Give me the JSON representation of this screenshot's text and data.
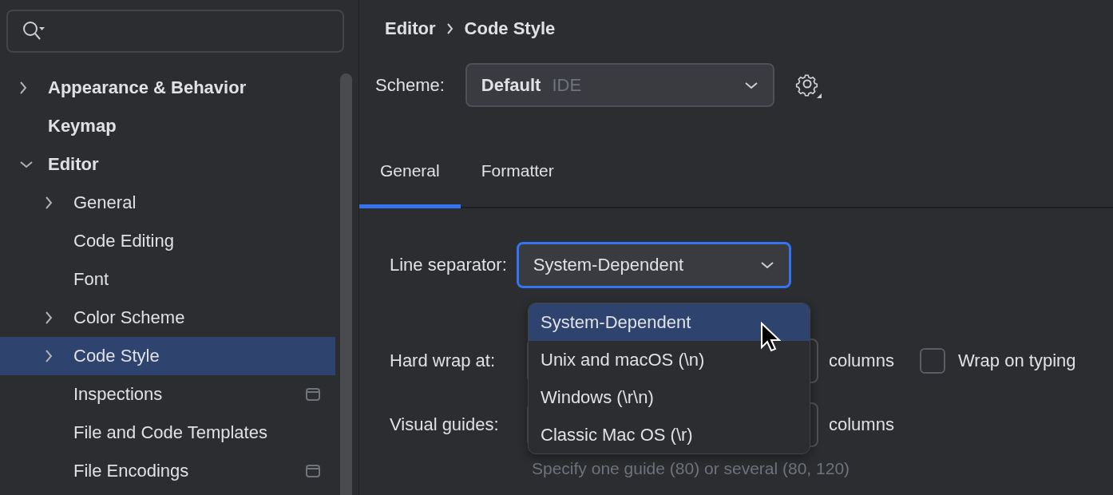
{
  "tree": [
    {
      "label": "Appearance & Behavior",
      "expanded": false,
      "selected": false
    },
    {
      "label": "Keymap",
      "selected": false
    },
    {
      "label": "Editor",
      "expanded": true,
      "selected": false,
      "children": [
        {
          "label": "General",
          "expanded": false,
          "selected": false,
          "project_icon": false
        },
        {
          "label": "Code Editing",
          "selected": false,
          "project_icon": false
        },
        {
          "label": "Font",
          "selected": false,
          "project_icon": false
        },
        {
          "label": "Color Scheme",
          "expanded": false,
          "selected": false,
          "project_icon": false
        },
        {
          "label": "Code Style",
          "expanded": false,
          "selected": true,
          "project_icon": false
        },
        {
          "label": "Inspections",
          "selected": false,
          "project_icon": true
        },
        {
          "label": "File and Code Templates",
          "selected": false,
          "project_icon": false
        },
        {
          "label": "File Encodings",
          "selected": false,
          "project_icon": true
        }
      ]
    }
  ],
  "breadcrumb": [
    "Editor",
    "Code Style"
  ],
  "scheme": {
    "label": "Scheme:",
    "value": "Default",
    "qualifier": "IDE"
  },
  "tabs": [
    {
      "label": "General",
      "selected": true
    },
    {
      "label": "Formatter",
      "selected": false
    }
  ],
  "line_separator": {
    "label": "Line separator:",
    "value": "System-Dependent",
    "focused": true,
    "options": [
      {
        "label": "System-Dependent",
        "selected": true
      },
      {
        "label": "Unix and macOS (\\n)",
        "selected": false
      },
      {
        "label": "Windows (\\r\\n)",
        "selected": false
      },
      {
        "label": "Classic Mac OS (\\r)",
        "selected": false
      }
    ]
  },
  "hard_wrap": {
    "label": "Hard wrap at:",
    "unit": "columns",
    "wrap_on_typing": {
      "label": "Wrap on typing",
      "checked": false
    }
  },
  "visual_guides": {
    "label": "Visual guides:",
    "unit": "columns",
    "hint": "Specify one guide (80) or several (80, 120)"
  }
}
